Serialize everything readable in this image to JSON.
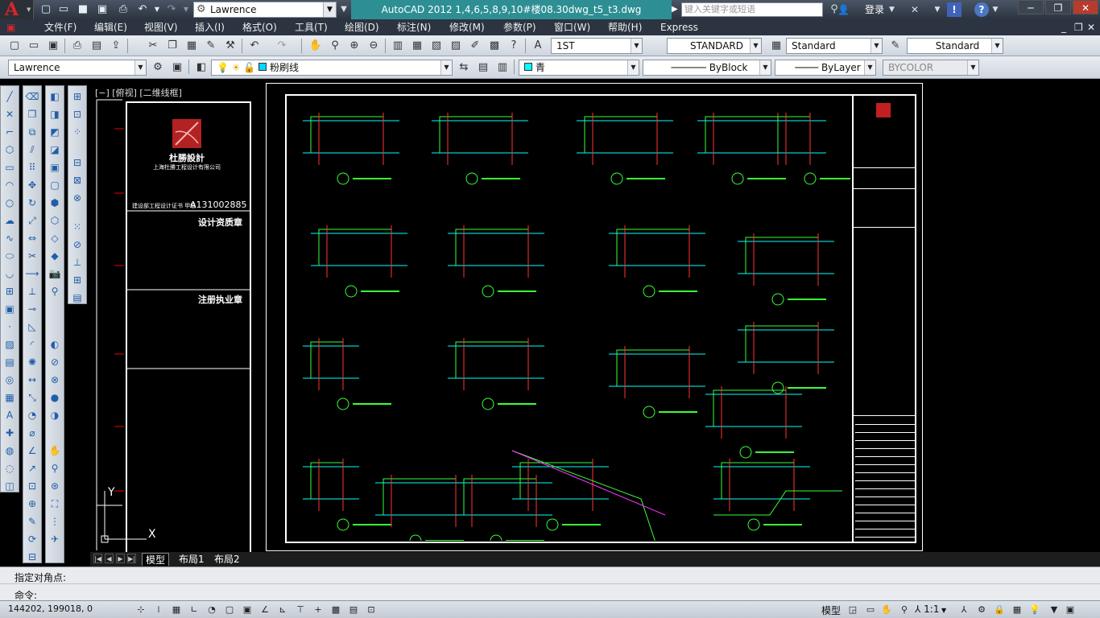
{
  "titlebar": {
    "workspace": "Lawrence",
    "document_title": "AutoCAD 2012    1,4,6,5,8,9,10#楼08.30dwg_t5_t3.dwg",
    "search_placeholder": "键入关键字或短语",
    "login": "登录"
  },
  "menu": {
    "items": [
      "文件(F)",
      "编辑(E)",
      "视图(V)",
      "插入(I)",
      "格式(O)",
      "工具(T)",
      "绘图(D)",
      "标注(N)",
      "修改(M)",
      "参数(P)",
      "窗口(W)",
      "帮助(H)",
      "Express"
    ]
  },
  "toolbar1": {
    "dim_style": "1ST",
    "text_style": "STANDARD",
    "table_style": "Standard",
    "multileader_style": "Standard"
  },
  "toolbar2": {
    "workspace": "Lawrence",
    "layer": "粉刷线",
    "color": "青",
    "linetype": "ByBlock",
    "lineweight": "ByLayer",
    "plotstyle": "BYCOLOR"
  },
  "drawing": {
    "view_label": "[−] [俯视] [二维线框]",
    "company_name": "杜勝設計",
    "company_sub": "上海杜勝工程设计有限公司",
    "license_text": "建设部工程设计证书 甲级",
    "license_no": "A131002885",
    "design_seal": "设计资质章",
    "registered_seal": "注册执业章"
  },
  "tabs": [
    "模型",
    "布局1",
    "布局2"
  ],
  "command": {
    "history": "指定对角点:",
    "prompt": "命令:"
  },
  "status": {
    "coords": "144202, 199018, 0",
    "model": "模型",
    "scale": "1:1"
  },
  "colors": {
    "title_accent": "#2d8f93",
    "cad_green": "#39ff39",
    "cad_cyan": "#00ffff"
  }
}
